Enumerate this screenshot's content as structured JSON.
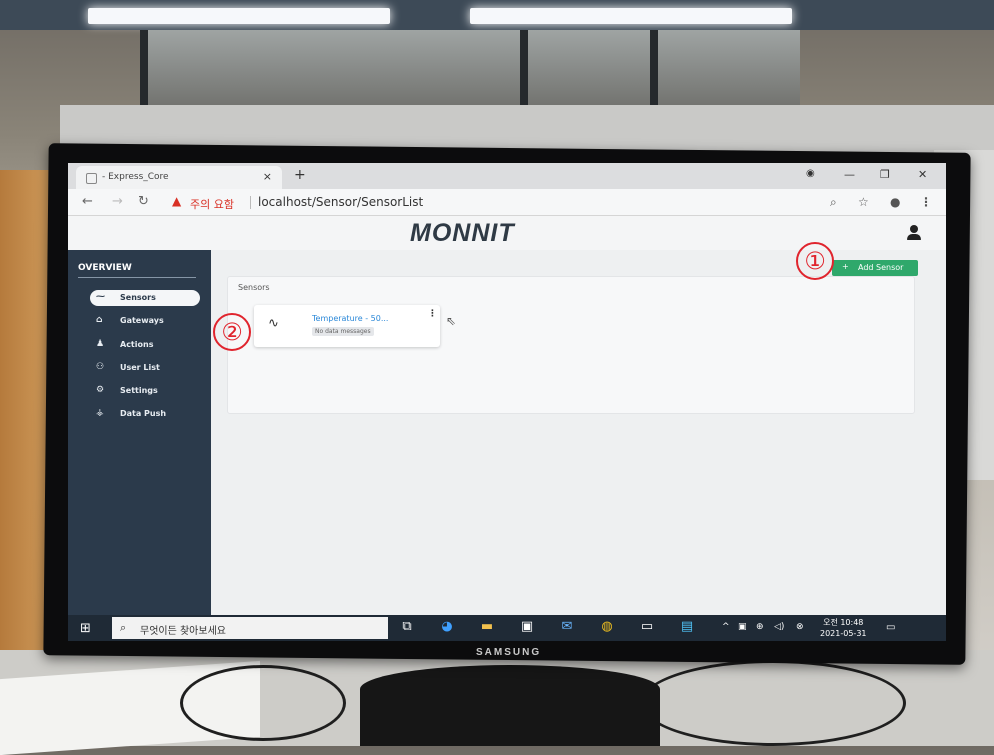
{
  "browser": {
    "tab_title": "- Express_Core",
    "tab_close": "×",
    "new_tab": "+",
    "not_secure": "주의 요함",
    "url": "localhost/Sensor/SensorList",
    "minimize": "—",
    "maximize": "❐",
    "close": "✕"
  },
  "app": {
    "logo": "MONNIT",
    "add_button": "Add Sensor",
    "add_plus": "+",
    "sidebar_title": "OVERVIEW",
    "sidebar": [
      {
        "label": "Sensors",
        "icon": "pulse-icon",
        "active": true
      },
      {
        "label": "Gateways",
        "icon": "router-icon",
        "active": false
      },
      {
        "label": "Actions",
        "icon": "bell-icon",
        "active": false
      },
      {
        "label": "User List",
        "icon": "users-icon",
        "active": false
      },
      {
        "label": "Settings",
        "icon": "gear-icon",
        "active": false
      },
      {
        "label": "Data Push",
        "icon": "network-icon",
        "active": false
      }
    ],
    "panel_title": "Sensors",
    "sensor_card": {
      "name": "Temperature - 50...",
      "status": "No data messages",
      "menu": "⋮"
    }
  },
  "taskbar": {
    "search_placeholder": "무엇이든 찾아보세요",
    "time": "오전 10:48",
    "date": "2021-05-31"
  },
  "annotations": {
    "first": "①",
    "second": "②"
  },
  "monitor_brand": "SAMSUNG",
  "colors": {
    "sidebar": "#2b3a4b",
    "add_button": "#2fa86b",
    "annotation": "#e0242d",
    "link": "#2b88d8"
  }
}
